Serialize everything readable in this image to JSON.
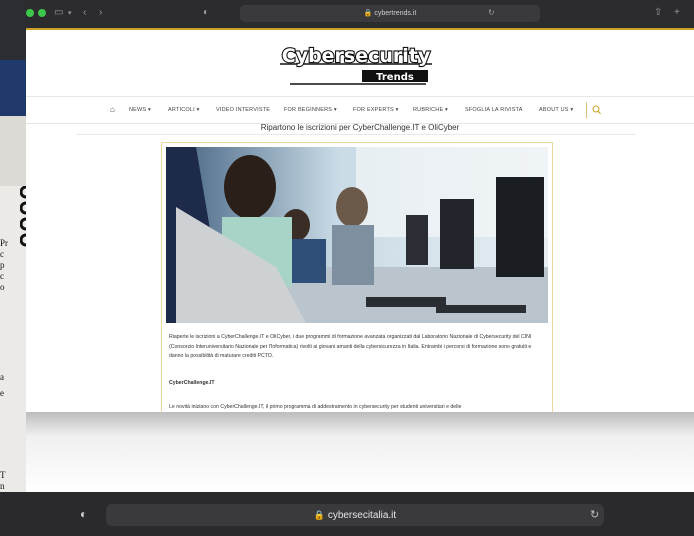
{
  "browser": {
    "top_address": "cybertrends.it",
    "bottom_address": "cybersecitalia.it"
  },
  "site": {
    "logo_line1": "Cybersecurity",
    "logo_line2": "Trends",
    "nav": [
      "NEWS ▾",
      "ARTICOLI ▾",
      "VIDEO INTERVISTE",
      "FOR BEGINNERS ▾",
      "FOR EXPERTS ▾",
      "RUBRICHE ▾",
      "SFOGLIA LA RIVISTA",
      "ABOUT US ▾"
    ]
  },
  "article": {
    "title": "Ripartono le iscrizioni per CyberChallenge.IT e OliCyber",
    "para1": "Riaperte le iscrizioni a CyberChallenge.IT e OliCyber, i due programmi di formazione avanzata organizzati dal Laboratorio Nazionale di Cybersecurity del CINI (Consorzio Interuniversitario Nazionale per l'Informatica) rivolti ai giovani amanti della cybersicurezza in Italia. Entrambi i percorsi di formazione sono gratuiti e danno la possibilità di maturare crediti PCTO.",
    "subheading": "CyberChallenge.IT",
    "para2": "Le novità iniziano con CyberChallenge.IT, il primo programma di addestramento in cybersecurity per studenti universitari e delle"
  },
  "back_window": {
    "lines_a": [
      "Pr",
      "c",
      "p",
      "c",
      "o"
    ],
    "line_b": "a",
    "line_c": "e",
    "lines_d": [
      "T",
      "n"
    ]
  },
  "colors": {
    "accent": "#c9a227",
    "toolbar": "#2c2c2e"
  }
}
